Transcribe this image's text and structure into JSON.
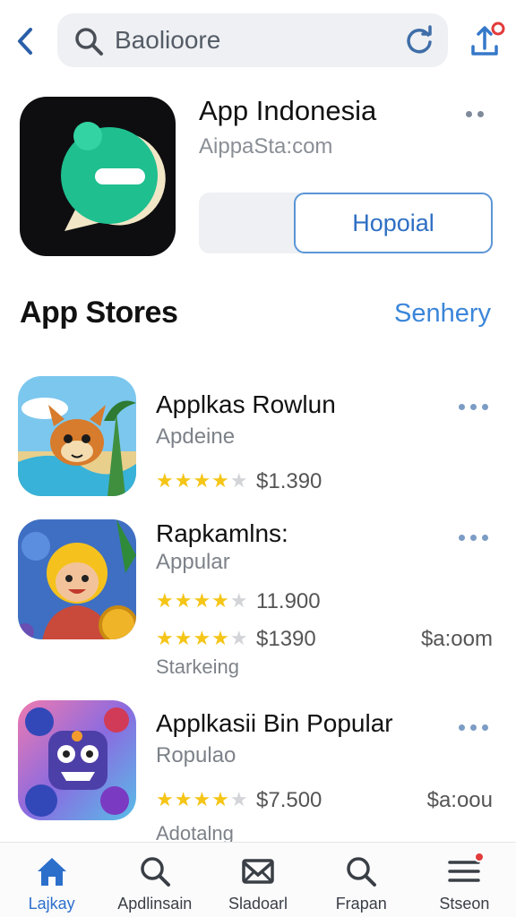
{
  "search": {
    "query": "Baolioore"
  },
  "app": {
    "title": "App Indonesia",
    "subtitle": "AippaSta:com",
    "primary_button": "Hopoial"
  },
  "section": {
    "title": "App Stores",
    "link": "Senhery"
  },
  "rows": [
    {
      "title": "Applkas Rowlun",
      "subtitle": "Apdeine",
      "rating": 4,
      "price": "$1.390"
    },
    {
      "title": "Rapkamlns:",
      "subtitle": "Appular",
      "rating": 4,
      "price": "11.900",
      "rating2": 4,
      "price2": "$1390",
      "right_price": "$a:oom",
      "extra": "Starkeing"
    },
    {
      "title": "Applkasii Bin Popular",
      "subtitle": "Ropulao",
      "rating": 4,
      "price": "$7.500",
      "right_price": "$a:oou",
      "extra": "Adotalng"
    }
  ],
  "nav": [
    {
      "label": "Lajkay",
      "icon": "home-icon",
      "active": true
    },
    {
      "label": "Apdlinsain",
      "icon": "search-icon"
    },
    {
      "label": "Sladoarl",
      "icon": "mail-icon"
    },
    {
      "label": "Frapan",
      "icon": "search-icon"
    },
    {
      "label": "Stseon",
      "icon": "menu-icon",
      "badge": true
    }
  ],
  "colors": {
    "accent": "#3b86d9",
    "star": "#f5c517",
    "badge": "#e23b3b",
    "app_icon_green": "#1fbf8f"
  }
}
